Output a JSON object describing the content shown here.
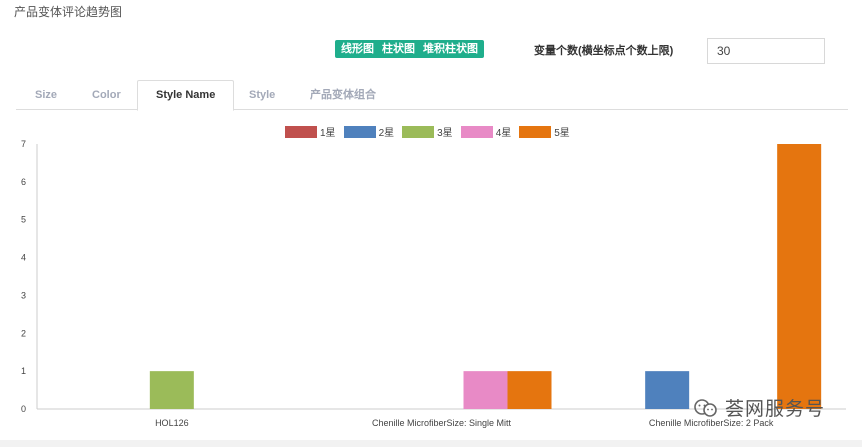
{
  "page": {
    "title": "产品变体评论趋势图"
  },
  "toolbar": {
    "chart_types": [
      "线形图",
      "柱状图",
      "堆积柱状图"
    ],
    "variable_count_label": "变量个数(横坐标点个数上限)",
    "variable_count_value": "30"
  },
  "tabs": [
    {
      "label": "Size",
      "active": false
    },
    {
      "label": "Color",
      "active": false
    },
    {
      "label": "Style Name",
      "active": true
    },
    {
      "label": "Style",
      "active": false
    },
    {
      "label": "产品变体组合",
      "active": false
    }
  ],
  "chart_data": {
    "type": "bar",
    "categories": [
      "HOL126",
      "Chenille MicrofiberSize: Single Mitt",
      "Chenille MicrofiberSize: 2 Pack"
    ],
    "series": [
      {
        "name": "1星",
        "color": "#c0504d",
        "values": [
          0,
          0,
          0
        ]
      },
      {
        "name": "2星",
        "color": "#4f81bd",
        "values": [
          0,
          0,
          1
        ]
      },
      {
        "name": "3星",
        "color": "#9bbb59",
        "values": [
          1,
          0,
          0
        ]
      },
      {
        "name": "4星",
        "color": "#e88ac6",
        "values": [
          0,
          1,
          0
        ]
      },
      {
        "name": "5星",
        "color": "#e5750f",
        "values": [
          0,
          1,
          7
        ]
      }
    ],
    "ylim": [
      0,
      7
    ],
    "yticks": [
      0,
      1,
      2,
      3,
      4,
      5,
      6,
      7
    ],
    "legend_position": "top-center",
    "grid": false
  },
  "watermark": {
    "text": "荟网服务号",
    "icon": "wechat-icon"
  }
}
